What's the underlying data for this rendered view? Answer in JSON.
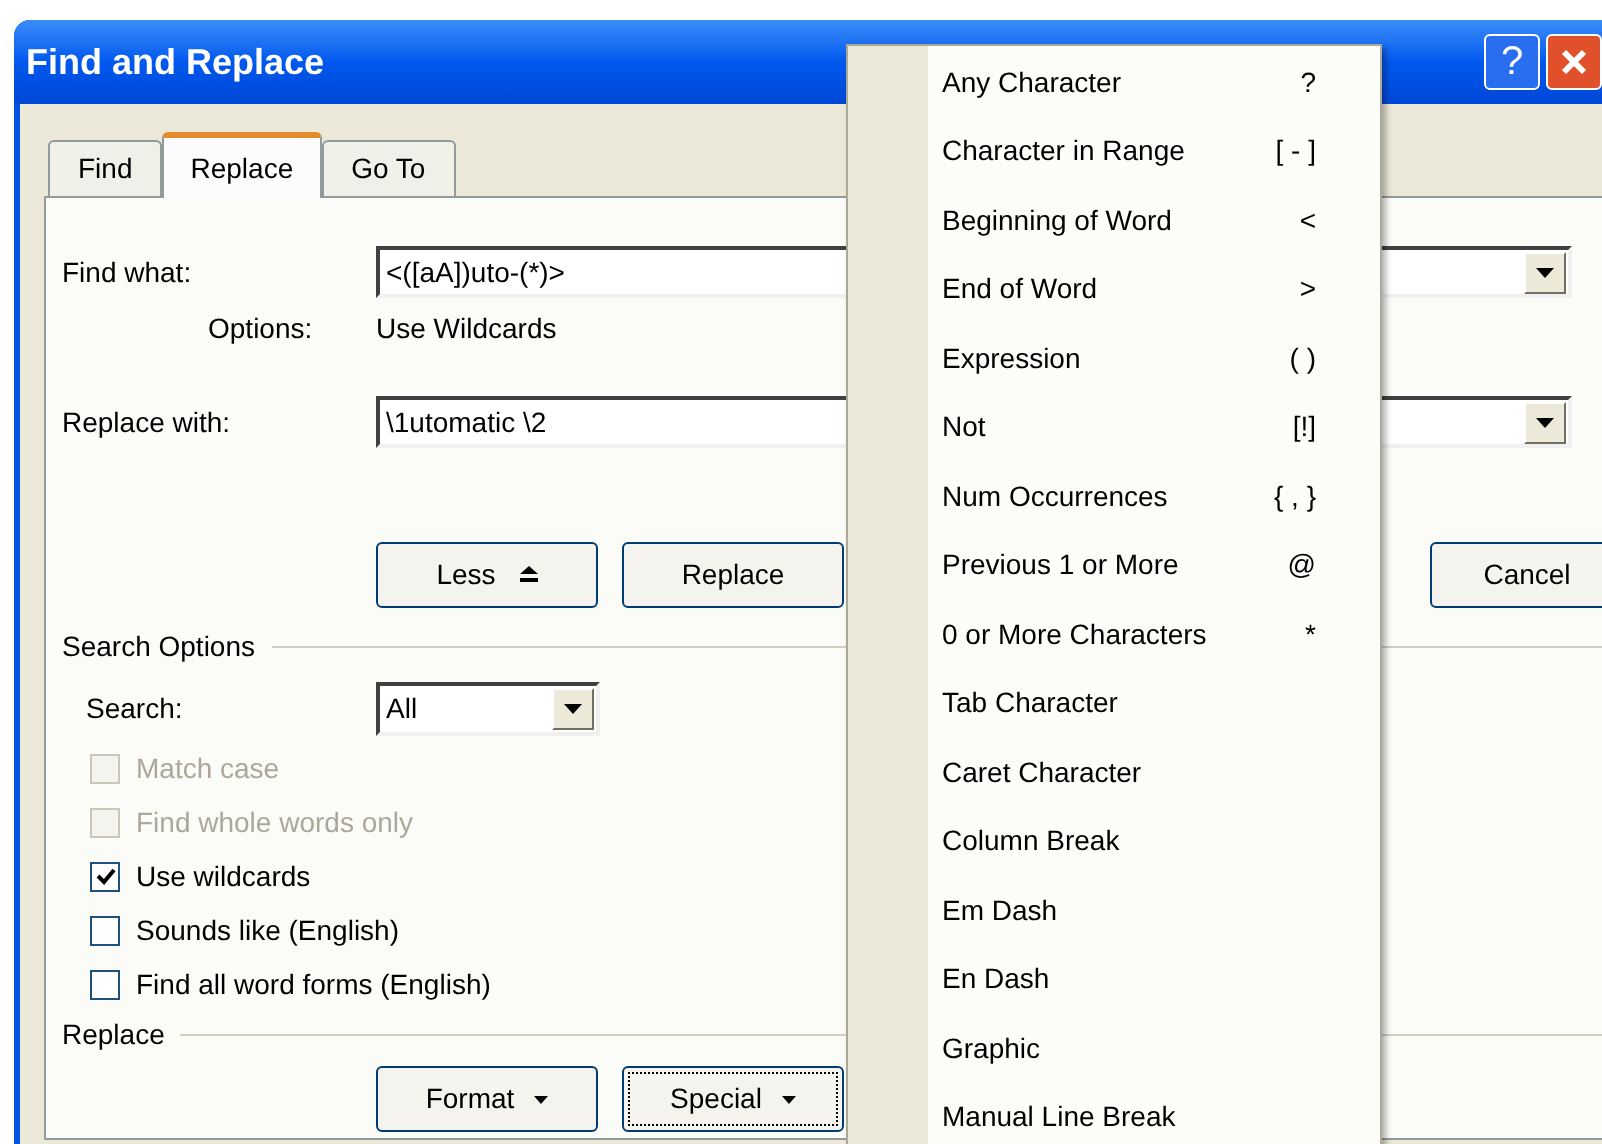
{
  "window": {
    "title": "Find and Replace",
    "help_button": "?"
  },
  "tabs": [
    {
      "label": "Find",
      "selected": false
    },
    {
      "label": "Replace",
      "selected": true
    },
    {
      "label": "Go To",
      "selected": false
    }
  ],
  "find_what": {
    "label": "Find what:",
    "value": "<([aA])uto-(*)>"
  },
  "options": {
    "label": "Options:",
    "value": "Use Wildcards"
  },
  "replace_with": {
    "label": "Replace with:",
    "value": "\\1utomatic \\2"
  },
  "buttons": [
    {
      "label": "Less",
      "kind": "less"
    },
    {
      "label": "Replace",
      "kind": "plain"
    },
    {
      "label": "Cancel",
      "kind": "plain"
    }
  ],
  "search_options": {
    "label": "Search Options",
    "search_label": "Search:",
    "search_value": "All"
  },
  "checkboxes": [
    {
      "label": "Match case",
      "checked": false,
      "disabled": true
    },
    {
      "label": "Find whole words only",
      "checked": false,
      "disabled": true
    },
    {
      "label": "Use wildcards",
      "checked": true,
      "disabled": false
    },
    {
      "label": "Sounds like (English)",
      "checked": false,
      "disabled": false
    },
    {
      "label": "Find all word forms (English)",
      "checked": false,
      "disabled": false
    }
  ],
  "replace_section": {
    "label": "Replace"
  },
  "replace_buttons": [
    {
      "label": "Format",
      "focused": false
    },
    {
      "label": "Special",
      "focused": true
    }
  ],
  "special_menu": [
    {
      "label": "Any Character",
      "shortcut": "?"
    },
    {
      "label": "Character in Range",
      "shortcut": "[ - ]"
    },
    {
      "label": "Beginning of Word",
      "shortcut": "<"
    },
    {
      "label": "End of Word",
      "shortcut": ">"
    },
    {
      "label": "Expression",
      "shortcut": "( )"
    },
    {
      "label": "Not",
      "shortcut": "[!]"
    },
    {
      "label": "Num Occurrences",
      "shortcut": "{ , }"
    },
    {
      "label": "Previous 1 or More",
      "shortcut": "@"
    },
    {
      "label": "0 or More Characters",
      "shortcut": "*"
    },
    {
      "label": "Tab Character"
    },
    {
      "label": "Caret Character"
    },
    {
      "label": "Column Break"
    },
    {
      "label": "Em Dash"
    },
    {
      "label": "En Dash"
    },
    {
      "label": "Graphic"
    },
    {
      "label": "Manual Line Break"
    }
  ]
}
